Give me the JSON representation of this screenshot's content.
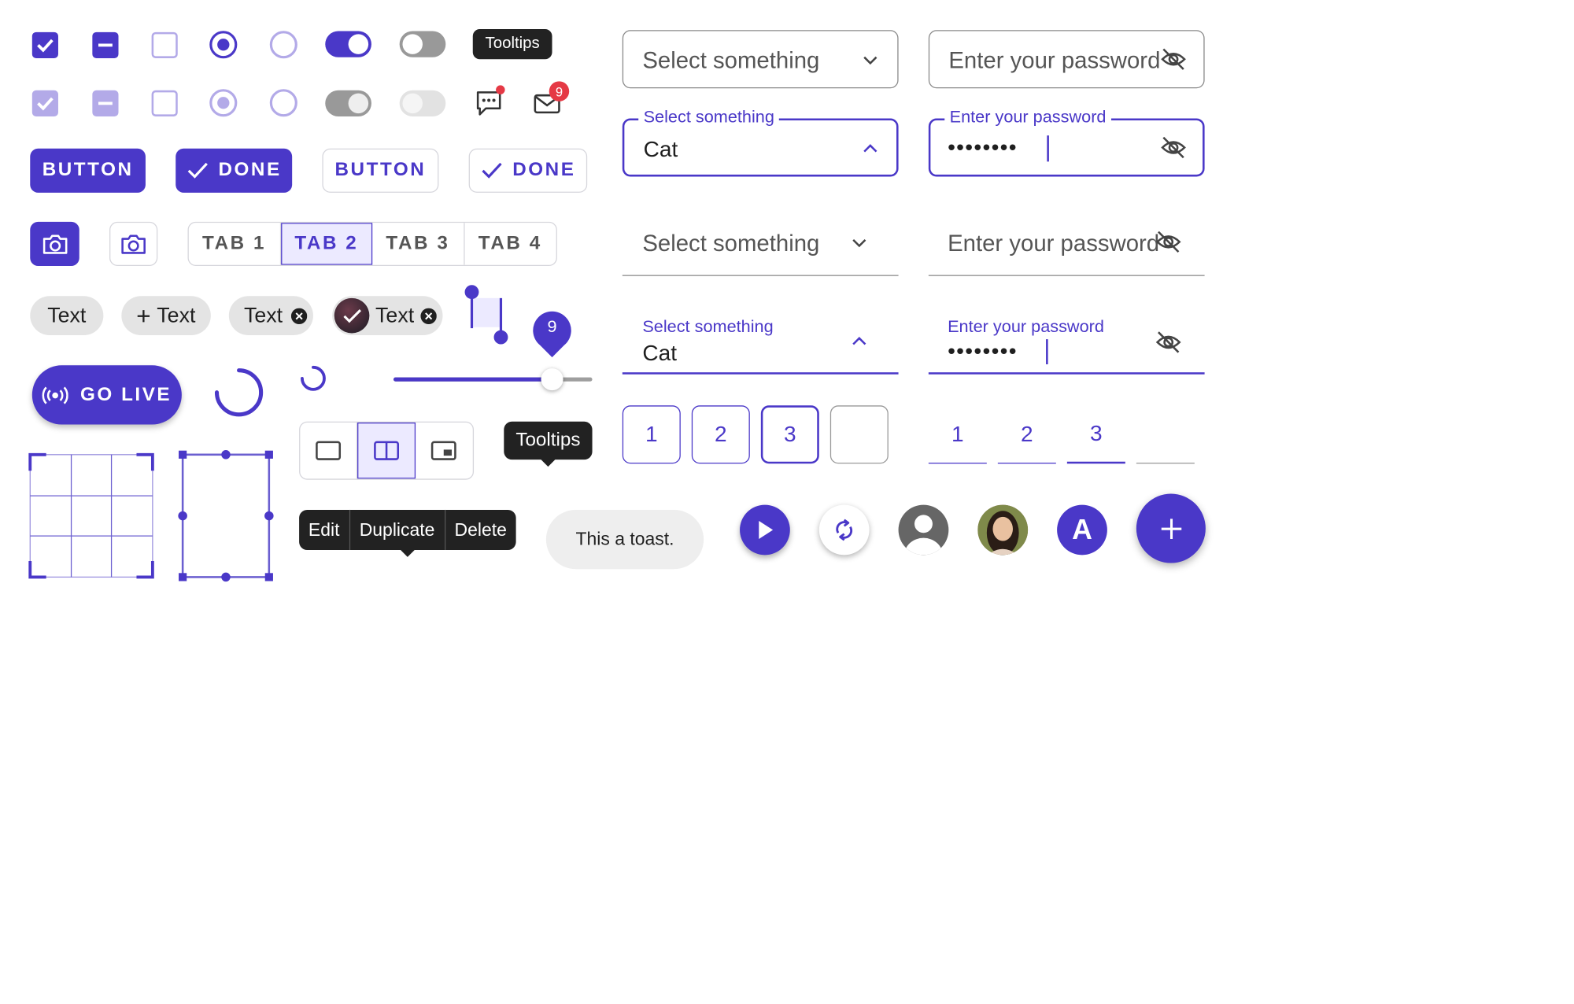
{
  "colors": {
    "accent": "#4a38c8",
    "accent_light": "#b3aae8",
    "dark": "#222222",
    "badge_red": "#e53945"
  },
  "tooltip_small": "Tooltips",
  "notification_badge": "9",
  "buttons": {
    "button": "BUTTON",
    "done": "DONE"
  },
  "tabs": [
    "TAB 1",
    "TAB 2",
    "TAB 3",
    "TAB 4"
  ],
  "chips": {
    "plain": "Text",
    "add": "Text",
    "removable": "Text",
    "avatar": "Text"
  },
  "slider": {
    "value": 9,
    "value_label": "9",
    "fraction": 0.8
  },
  "go_live": "GO LIVE",
  "tooltip_large": "Tooltips",
  "context_menu": [
    "Edit",
    "Duplicate",
    "Delete"
  ],
  "toast": "This a toast.",
  "avatar_letter": "A",
  "select": {
    "placeholder": "Select something",
    "label": "Select something",
    "value": "Cat"
  },
  "password": {
    "placeholder": "Enter your password",
    "label": "Enter your password",
    "masked": "••••••••"
  },
  "otp_boxed": [
    "1",
    "2",
    "3",
    ""
  ],
  "otp_underline": [
    "1",
    "2",
    "3",
    ""
  ]
}
